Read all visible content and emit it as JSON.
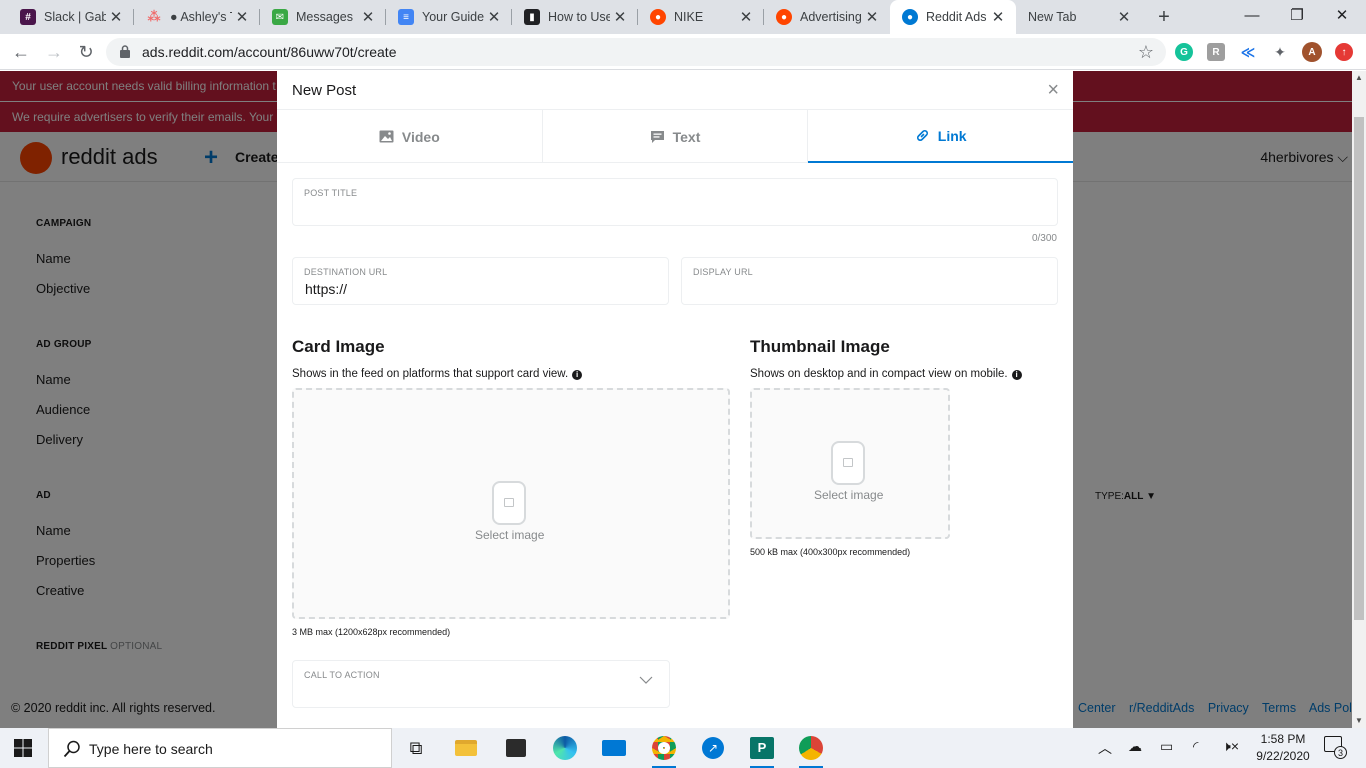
{
  "browser": {
    "tabs": [
      {
        "label": "Slack | Gabe",
        "favicon": "slack-icon",
        "color": "#4a154b"
      },
      {
        "label": "● Ashley's T",
        "favicon": "asana-icon",
        "color": "#f06a6a"
      },
      {
        "label": "Messages",
        "favicon": "messages-icon",
        "color": "#3aa845"
      },
      {
        "label": "Your Guide",
        "favicon": "docs-icon",
        "color": "#4285f4"
      },
      {
        "label": "How to Use",
        "favicon": "bookmark-icon",
        "color": "#202124"
      },
      {
        "label": "NIKE",
        "favicon": "reddit-icon",
        "color": "#ff4500"
      },
      {
        "label": "Advertising",
        "favicon": "reddit-icon",
        "color": "#ff4500"
      },
      {
        "label": "Reddit Ads",
        "favicon": "reddit-ads-icon",
        "color": "#0079d3"
      },
      {
        "label": "New Tab",
        "favicon": "",
        "color": ""
      }
    ],
    "url": "ads.reddit.com/account/86uww70t/create"
  },
  "background": {
    "banner_billing": "Your user account needs valid billing information t",
    "banner_email": "We require advertisers to verify their emails. Your a",
    "logo_text": "reddit ads",
    "create_label": "Create",
    "account_name": "4herbivores",
    "sidebar": {
      "campaign_head": "CAMPAIGN",
      "campaign_items": [
        "Name",
        "Objective"
      ],
      "adgroup_head": "AD GROUP",
      "adgroup_items": [
        "Name",
        "Audience",
        "Delivery"
      ],
      "ad_head": "AD",
      "ad_items": [
        "Name",
        "Properties",
        "Creative"
      ],
      "pixel_head": "REDDIT PIXEL",
      "pixel_optional": "OPTIONAL"
    },
    "type_label": "TYPE:",
    "type_value": "ALL",
    "footer_copy": "© 2020 reddit inc. All rights reserved.",
    "footer_links": [
      "Center",
      "r/RedditAds",
      "Privacy",
      "Terms",
      "Ads Polic"
    ]
  },
  "modal": {
    "title": "New Post",
    "tabs": [
      {
        "label": "Video",
        "icon": "image-icon"
      },
      {
        "label": "Text",
        "icon": "text-post-icon"
      },
      {
        "label": "Link",
        "icon": "link-icon"
      }
    ],
    "active_tab": "Link",
    "post_title_label": "POST TITLE",
    "post_title_value": "",
    "char_count": "0/300",
    "destination_url_label": "DESTINATION URL",
    "destination_url_value": "https://",
    "display_url_label": "DISPLAY URL",
    "display_url_value": "",
    "card_image": {
      "title": "Card Image",
      "desc": "Shows in the feed on platforms that support card view.",
      "select_label": "Select image",
      "size_note": "3 MB max (1200x628px recommended)"
    },
    "thumbnail_image": {
      "title": "Thumbnail Image",
      "desc": "Shows on desktop and in compact view on mobile.",
      "select_label": "Select image",
      "size_note": "500 kB max (400x300px recommended)"
    },
    "cta_label": "CALL TO ACTION",
    "cta_value": ""
  },
  "taskbar": {
    "search_placeholder": "Type here to search",
    "time": "1:58 PM",
    "date": "9/22/2020",
    "notification_count": "3"
  },
  "colors": {
    "accent": "#0079d3",
    "banner": "#c6203c",
    "reddit_orange": "#ff4500"
  }
}
